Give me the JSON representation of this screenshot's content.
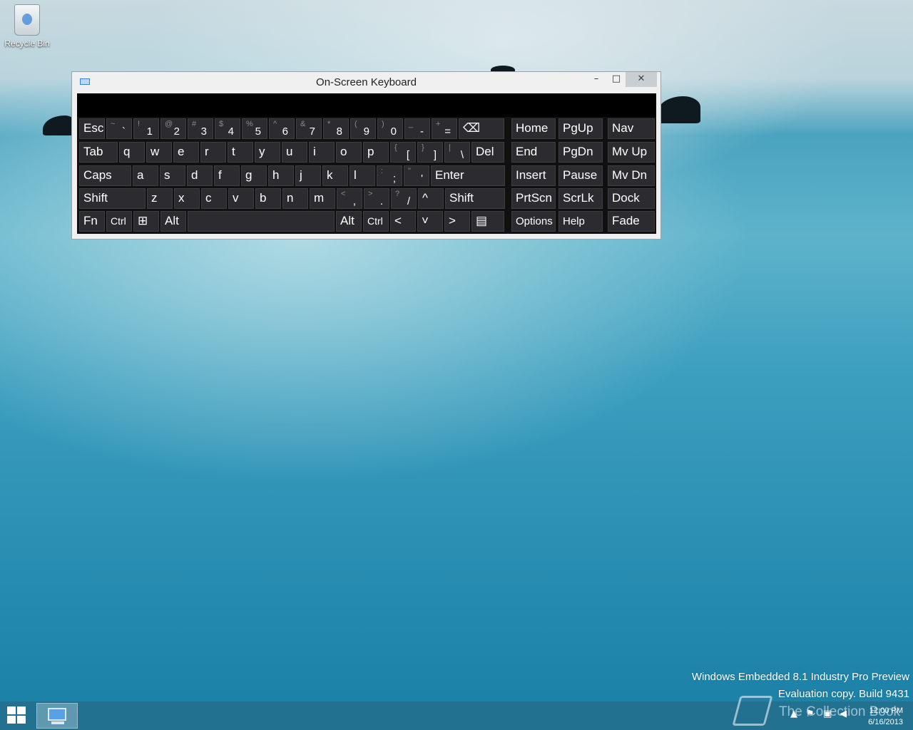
{
  "desktop": {
    "recycle_bin_label": "Recycle Bin",
    "watermark_line1": "Windows Embedded 8.1 Industry Pro Preview",
    "watermark_line2": "Evaluation copy. Build 9431",
    "overlay_text": "The Collection Book"
  },
  "osk": {
    "title": "On-Screen Keyboard",
    "controls": {
      "minimize": "–",
      "maximize": "□",
      "close": "✕"
    },
    "row1": [
      {
        "m": "Esc"
      },
      {
        "s": "~",
        "m": "`"
      },
      {
        "s": "!",
        "m": "1"
      },
      {
        "s": "@",
        "m": "2"
      },
      {
        "s": "#",
        "m": "3"
      },
      {
        "s": "$",
        "m": "4"
      },
      {
        "s": "%",
        "m": "5"
      },
      {
        "s": "^",
        "m": "6"
      },
      {
        "s": "&",
        "m": "7"
      },
      {
        "s": "*",
        "m": "8"
      },
      {
        "s": "(",
        "m": "9"
      },
      {
        "s": ")",
        "m": "0"
      },
      {
        "s": "_",
        "m": "-"
      },
      {
        "s": "+",
        "m": "="
      },
      {
        "m": "⌫"
      }
    ],
    "row2": [
      {
        "m": "Tab"
      },
      {
        "m": "q"
      },
      {
        "m": "w"
      },
      {
        "m": "e"
      },
      {
        "m": "r"
      },
      {
        "m": "t"
      },
      {
        "m": "y"
      },
      {
        "m": "u"
      },
      {
        "m": "i"
      },
      {
        "m": "o"
      },
      {
        "m": "p"
      },
      {
        "s": "{",
        "m": "["
      },
      {
        "s": "}",
        "m": "]"
      },
      {
        "s": "|",
        "m": "\\"
      },
      {
        "m": "Del"
      }
    ],
    "row3": [
      {
        "m": "Caps"
      },
      {
        "m": "a"
      },
      {
        "m": "s"
      },
      {
        "m": "d"
      },
      {
        "m": "f"
      },
      {
        "m": "g"
      },
      {
        "m": "h"
      },
      {
        "m": "j"
      },
      {
        "m": "k"
      },
      {
        "m": "l"
      },
      {
        "s": ":",
        "m": ";"
      },
      {
        "s": "\"",
        "m": "'"
      },
      {
        "m": "Enter"
      }
    ],
    "row4": [
      {
        "m": "Shift"
      },
      {
        "m": "z"
      },
      {
        "m": "x"
      },
      {
        "m": "c"
      },
      {
        "m": "v"
      },
      {
        "m": "b"
      },
      {
        "m": "n"
      },
      {
        "m": "m"
      },
      {
        "s": "<",
        "m": ","
      },
      {
        "s": ">",
        "m": "."
      },
      {
        "s": "?",
        "m": "/"
      },
      {
        "m": "^"
      },
      {
        "m": "Shift"
      }
    ],
    "row5": [
      {
        "m": "Fn"
      },
      {
        "m": "Ctrl"
      },
      {
        "m": "⊞"
      },
      {
        "m": "Alt"
      },
      {
        "m": ""
      },
      {
        "m": "Alt"
      },
      {
        "m": "Ctrl"
      },
      {
        "m": "<"
      },
      {
        "m": "˅"
      },
      {
        "m": ">"
      },
      {
        "m": "▤"
      }
    ],
    "nav_keys": [
      [
        "Home",
        "PgUp",
        "Nav"
      ],
      [
        "End",
        "PgDn",
        "Mv Up"
      ],
      [
        "Insert",
        "Pause",
        "Mv Dn"
      ],
      [
        "PrtScn",
        "ScrLk",
        "Dock"
      ],
      [
        "Options",
        "Help",
        "Fade"
      ]
    ]
  },
  "taskbar": {
    "clock_time": "12:00 PM",
    "clock_date": "6/16/2013",
    "tray_icons": [
      "up-arrow-icon",
      "flag-icon",
      "network-icon",
      "volume-icon"
    ]
  }
}
